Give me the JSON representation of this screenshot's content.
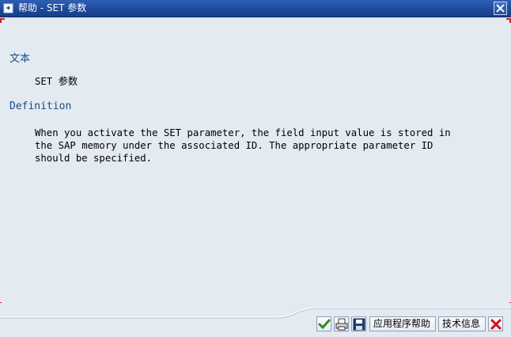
{
  "window": {
    "title": "帮助 - SET 参数",
    "title_icon": "help-window-icon",
    "close_icon": "close-icon"
  },
  "content": {
    "section1_heading": "文本",
    "section1_text": "SET 参数",
    "section2_heading": "Definition",
    "section2_text": "When you activate the SET parameter, the field input value is stored in\nthe SAP memory under the associated ID. The appropriate parameter ID\nshould be specified."
  },
  "toolbar": {
    "confirm_icon": "checkmark-icon",
    "print_icon": "print-icon",
    "save_icon": "save-icon",
    "app_help_label": "应用程序帮助",
    "tech_info_label": "技术信息",
    "cancel_icon": "cancel-icon"
  },
  "colors": {
    "title_bar": "#1d4a9a",
    "background": "#e3eaf1",
    "heading": "#1a4a8a",
    "corner_marks": "#d02020"
  }
}
